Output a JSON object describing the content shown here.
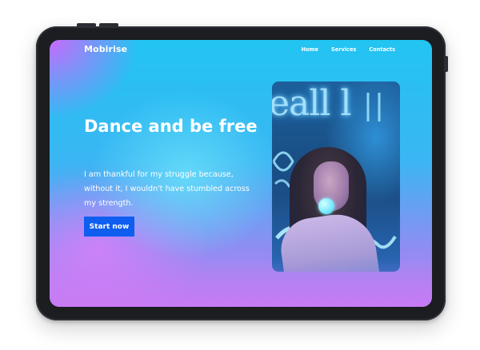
{
  "nav": {
    "brand": "Mobirise",
    "links": [
      "Home",
      "Services",
      "Contacts"
    ]
  },
  "hero": {
    "title": "Dance and be free",
    "text": "I am thankful for my struggle because, without it, I wouldn't have stumbled across my strength.",
    "cta_label": "Start now"
  },
  "image": {
    "neon_text": "eall l"
  },
  "colors": {
    "cta": "#0f5ef0",
    "gradient_top": "#22c4f2",
    "gradient_bottom": "#c47ef2",
    "corner_accent": "#e65aff",
    "device_frame": "#1b1d21"
  }
}
